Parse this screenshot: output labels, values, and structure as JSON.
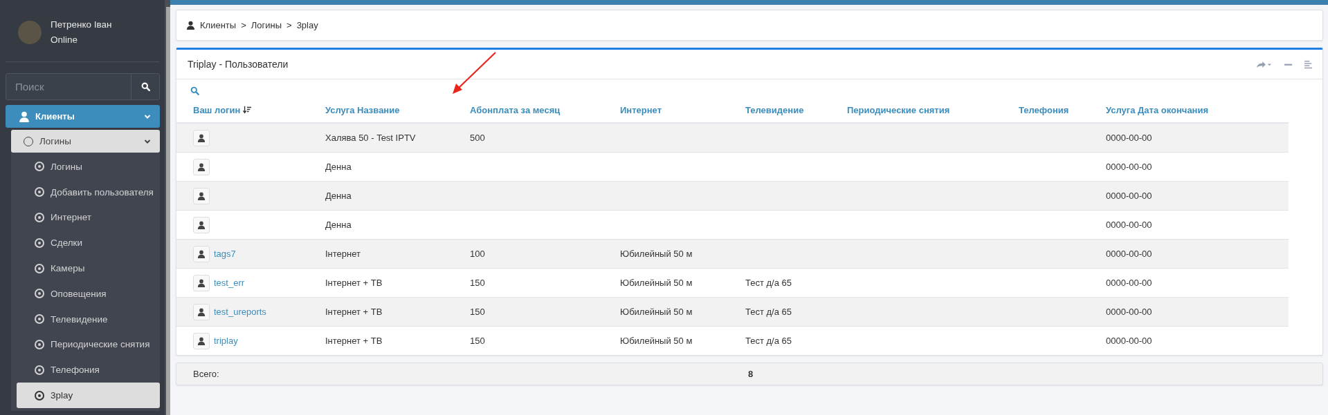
{
  "sidebar": {
    "user": {
      "name": "Петренко Іван",
      "status": "Online"
    },
    "search": {
      "placeholder": "Поиск"
    },
    "menu": [
      {
        "label": "Клиенты",
        "expanded": true,
        "children": [
          {
            "label": "Логины",
            "expanded": true,
            "children": [
              {
                "label": "Логины",
                "selected": false
              },
              {
                "label": "Добавить пользователя",
                "selected": false
              },
              {
                "label": "Интернет",
                "selected": false
              },
              {
                "label": "Сделки",
                "selected": false
              },
              {
                "label": "Камеры",
                "selected": false
              },
              {
                "label": "Оповещения",
                "selected": false
              },
              {
                "label": "Телевидение",
                "selected": false
              },
              {
                "label": "Периодические снятия",
                "selected": false
              },
              {
                "label": "Телефония",
                "selected": false
              },
              {
                "label": "3play",
                "selected": true
              }
            ]
          }
        ]
      }
    ]
  },
  "breadcrumb": [
    "Клиенты",
    "Логины",
    "3play"
  ],
  "breadcrumb_separator": ">",
  "panel": {
    "title": "Triplay - Пользователи",
    "table": {
      "columns": [
        {
          "label": "Ваш логин",
          "sorted": true
        },
        {
          "label": "Услуга Название",
          "sorted": false
        },
        {
          "label": "Абонплата за месяц",
          "sorted": false
        },
        {
          "label": "Интернет",
          "sorted": false
        },
        {
          "label": "Телевидение",
          "sorted": false
        },
        {
          "label": "Периодические снятия",
          "sorted": false
        },
        {
          "label": "Телефония",
          "sorted": false
        },
        {
          "label": "Услуга Дата окончания",
          "sorted": false
        }
      ],
      "rows": [
        {
          "login": "",
          "service": "Халява 50 - Test IPTV",
          "fee": "500",
          "internet": "",
          "tv": "",
          "periodic": "",
          "telephony": "",
          "end_date": "0000-00-00"
        },
        {
          "login": "",
          "service": "Денна",
          "fee": "",
          "internet": "",
          "tv": "",
          "periodic": "",
          "telephony": "",
          "end_date": "0000-00-00"
        },
        {
          "login": "",
          "service": "Денна",
          "fee": "",
          "internet": "",
          "tv": "",
          "periodic": "",
          "telephony": "",
          "end_date": "0000-00-00"
        },
        {
          "login": "",
          "service": "Денна",
          "fee": "",
          "internet": "",
          "tv": "",
          "periodic": "",
          "telephony": "",
          "end_date": "0000-00-00"
        },
        {
          "login": "tags7",
          "service": "Інтернет",
          "fee": "100",
          "internet": "Юбилейный 50 м",
          "tv": "",
          "periodic": "",
          "telephony": "",
          "end_date": "0000-00-00"
        },
        {
          "login": "test_err",
          "service": "Інтернет + ТВ",
          "fee": "150",
          "internet": "Юбилейный 50 м",
          "tv": "Тест д/а 65",
          "periodic": "",
          "telephony": "",
          "end_date": "0000-00-00"
        },
        {
          "login": "test_ureports",
          "service": "Інтернет + ТВ",
          "fee": "150",
          "internet": "Юбилейный 50 м",
          "tv": "Тест д/а 65",
          "periodic": "",
          "telephony": "",
          "end_date": "0000-00-00"
        },
        {
          "login": "triplay",
          "service": "Інтернет + ТВ",
          "fee": "150",
          "internet": "Юбилейный 50 м",
          "tv": "Тест д/а 65",
          "periodic": "",
          "telephony": "",
          "end_date": "0000-00-00"
        }
      ]
    }
  },
  "total": {
    "label": "Всего:",
    "value": "8"
  }
}
